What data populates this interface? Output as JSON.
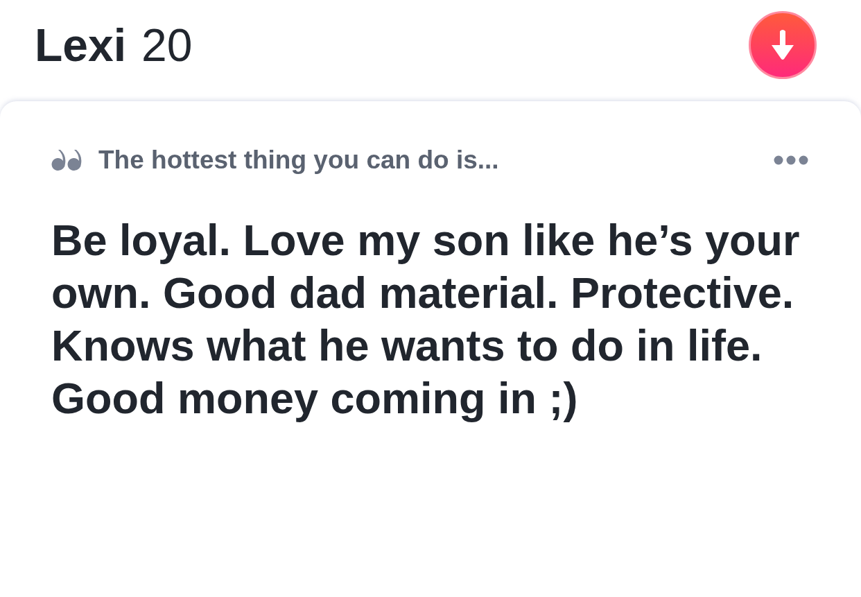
{
  "profile": {
    "name": "Lexi",
    "age": "20"
  },
  "prompt": {
    "question": "The hottest thing you can do is...",
    "answer": "Be loyal. Love my son like he’s your own. Good dad material. Protective. Knows what he wants to do in life. Good money coming in ;)"
  }
}
